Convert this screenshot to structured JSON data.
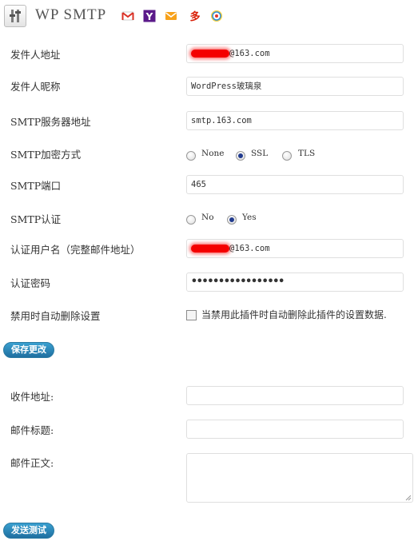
{
  "header": {
    "title": "WP  SMTP",
    "service_icons": [
      "gmail-icon",
      "yahoo-icon",
      "mail-envelope-icon",
      "163-mail-icon",
      "sina-weibo-icon"
    ]
  },
  "form": {
    "from_address_label": "发件人地址",
    "from_address_value": "@163.com",
    "from_name_label": "发件人昵称",
    "from_name_value": "WordPress玻璃泉",
    "smtp_host_label": "SMTP服务器地址",
    "smtp_host_value": "smtp.163.com",
    "encryption_label": "SMTP加密方式",
    "encryption_options": [
      "None",
      "SSL",
      "TLS"
    ],
    "encryption_selected": "SSL",
    "port_label": "SMTP端口",
    "port_value": "465",
    "auth_label": "SMTP认证",
    "auth_options": [
      "No",
      "Yes"
    ],
    "auth_selected": "Yes",
    "username_label": "认证用户名（完整邮件地址）",
    "username_value": "@163.com",
    "password_label": "认证密码",
    "password_value": "•••••••••••••••••",
    "delete_label": "禁用时自动删除设置",
    "delete_checkbox_text": "当禁用此插件时自动删除此插件的设置数据.",
    "save_button": "保存更改"
  },
  "test": {
    "to_label": "收件地址:",
    "subject_label": "邮件标题:",
    "body_label": "邮件正文:",
    "send_button": "发送测试"
  }
}
